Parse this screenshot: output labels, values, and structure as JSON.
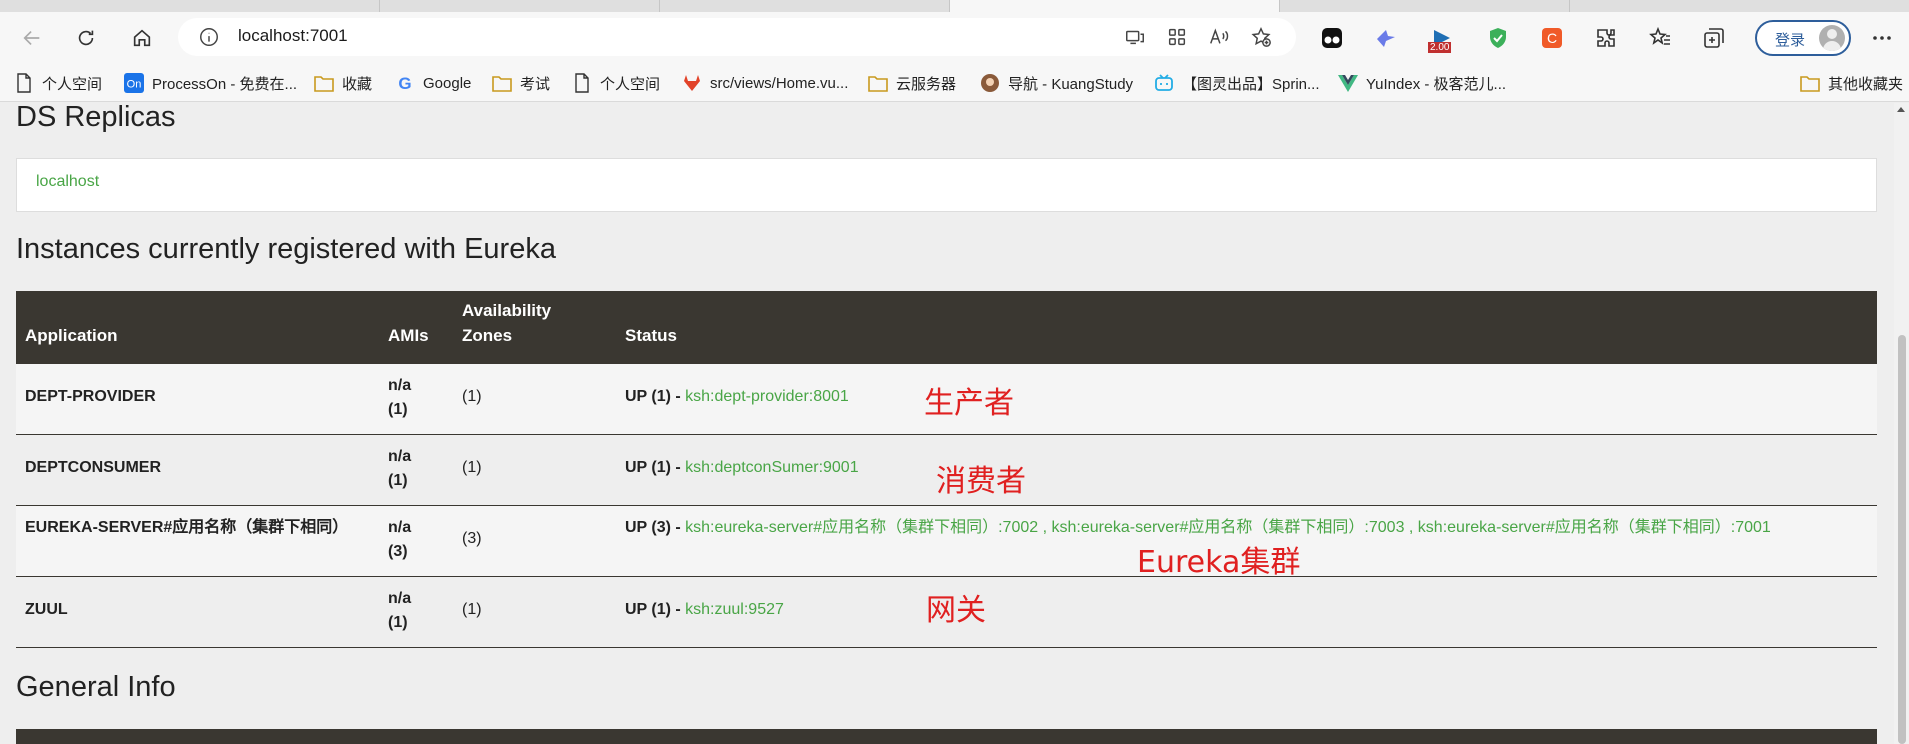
{
  "browser": {
    "address": {
      "url": "localhost:7001"
    },
    "login_label": "登录",
    "bookmarks": [
      {
        "label": "个人空间",
        "icon": "page-icon"
      },
      {
        "label": "ProcessOn - 免费在...",
        "icon": "processon-icon"
      },
      {
        "label": "收藏",
        "icon": "folder-icon"
      },
      {
        "label": "Google",
        "icon": "google-icon"
      },
      {
        "label": "考试",
        "icon": "folder-icon"
      },
      {
        "label": "个人空间",
        "icon": "page-icon"
      },
      {
        "label": "src/views/Home.vu...",
        "icon": "gitlab-icon"
      },
      {
        "label": "云服务器",
        "icon": "folder-icon"
      },
      {
        "label": "导航 - KuangStudy",
        "icon": "avatar-icon"
      },
      {
        "label": "【图灵出品】Sprin...",
        "icon": "bilibili-icon"
      },
      {
        "label": "YuIndex - 极客范儿...",
        "icon": "vue-icon"
      },
      {
        "label": "其他收藏夹",
        "icon": "folder-icon"
      }
    ],
    "extension_badge": "2.00"
  },
  "page": {
    "replicas_title": "DS Replicas",
    "replica_link": "localhost",
    "instances_title": "Instances currently registered with Eureka",
    "general_title": "General Info",
    "table": {
      "headers": {
        "application": "Application",
        "amis": "AMIs",
        "availability_zones": "Availability Zones",
        "status": "Status"
      },
      "rows": [
        {
          "application": "DEPT-PROVIDER",
          "amis": "n/a (1)",
          "zones": "(1)",
          "status_prefix": "UP (1) - ",
          "instances": "ksh:dept-provider:8001",
          "annotation": "生产者"
        },
        {
          "application": "DEPTCONSUMER",
          "amis": "n/a (1)",
          "zones": "(1)",
          "status_prefix": "UP (1) - ",
          "instances": "ksh:deptconSumer:9001",
          "annotation": "消费者"
        },
        {
          "application": "EUREKA-SERVER#应用名称（集群下相同）",
          "amis": "n/a (3)",
          "zones": "(3)",
          "status_prefix": "UP (3) - ",
          "instances": "ksh:eureka-server#应用名称（集群下相同）:7002 , ksh:eureka-server#应用名称（集群下相同）:7003 , ksh:eureka-server#应用名称（集群下相同）:7001",
          "annotation": "Eureka集群"
        },
        {
          "application": "ZUUL",
          "amis": "n/a (1)",
          "zones": "(1)",
          "status_prefix": "UP (1) - ",
          "instances": "ksh:zuul:9527",
          "annotation": "网关"
        }
      ]
    }
  },
  "colors": {
    "table_header": "#3a3731",
    "link_green": "#49a546",
    "annotation_red": "#e02020"
  }
}
